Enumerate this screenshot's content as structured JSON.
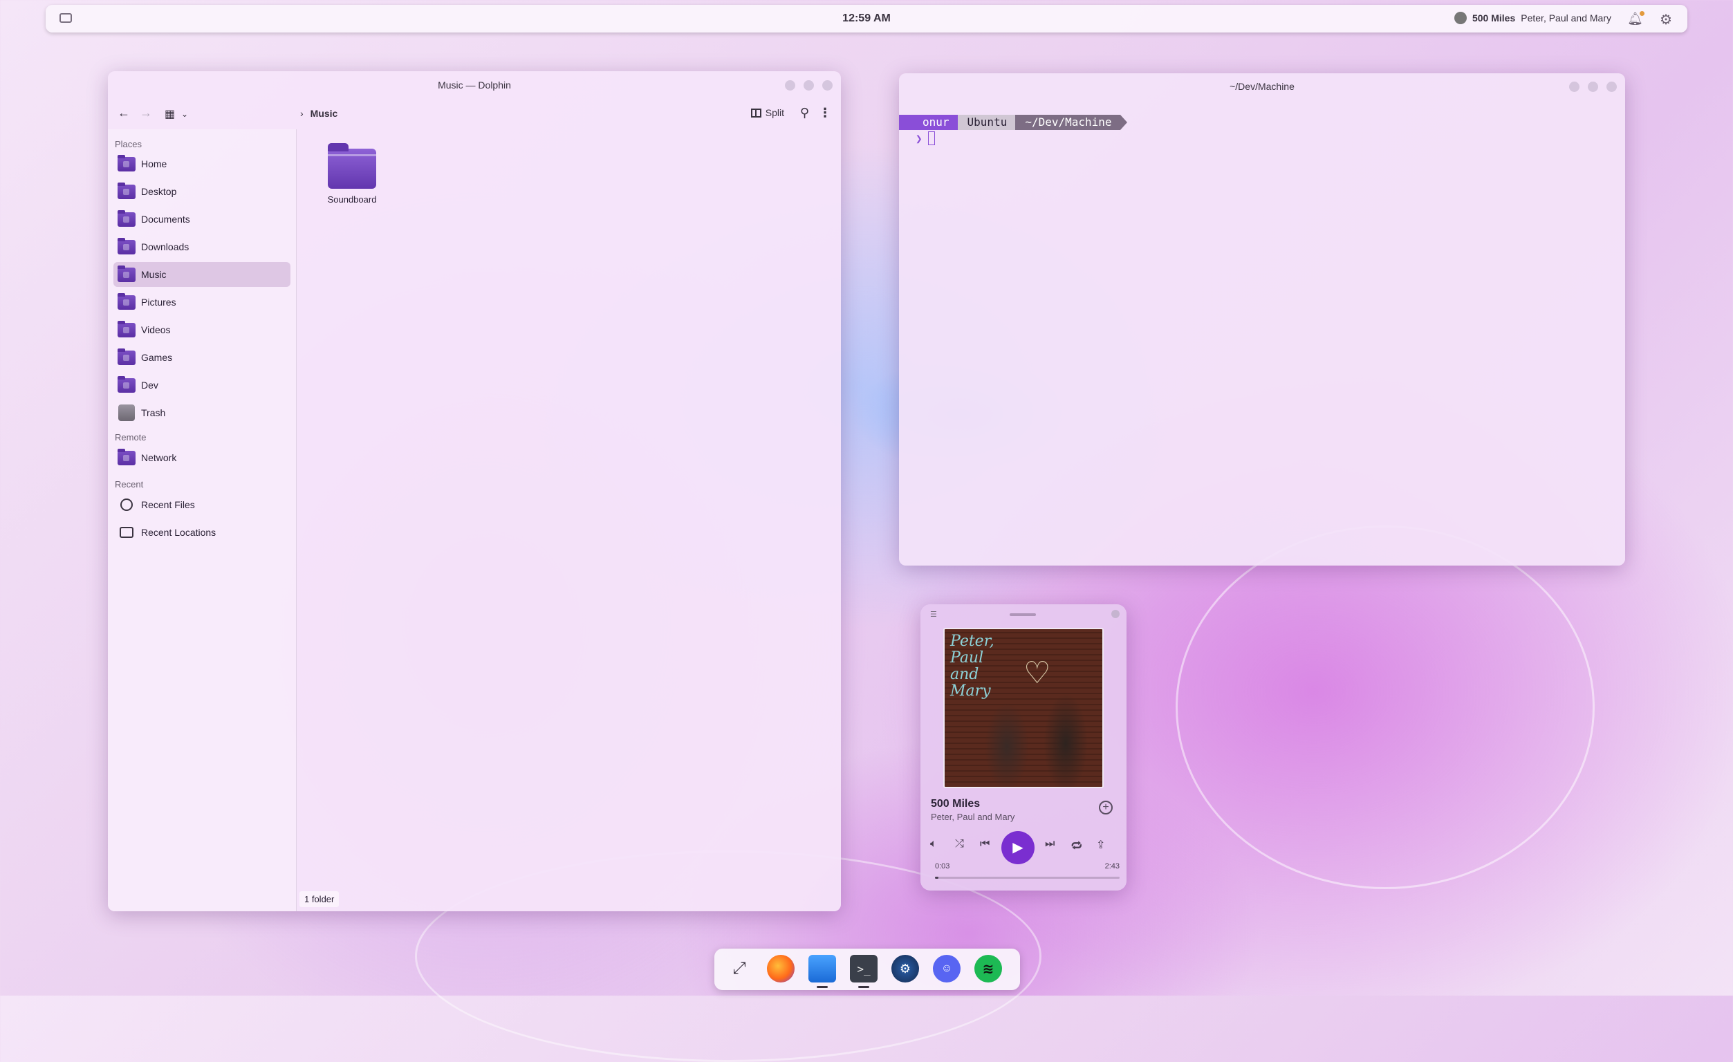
{
  "top_panel": {
    "clock": "12:59 AM",
    "media_title": "500 Miles",
    "media_artist": "Peter, Paul and Mary"
  },
  "dolphin": {
    "title": "Music — Dolphin",
    "breadcrumb": "Music",
    "split_label": "Split",
    "sections": {
      "places": "Places",
      "remote": "Remote",
      "recent": "Recent"
    },
    "places": [
      {
        "label": "Home"
      },
      {
        "label": "Desktop"
      },
      {
        "label": "Documents"
      },
      {
        "label": "Downloads"
      },
      {
        "label": "Music",
        "active": true
      },
      {
        "label": "Pictures"
      },
      {
        "label": "Videos"
      },
      {
        "label": "Games"
      },
      {
        "label": "Dev"
      },
      {
        "label": "Trash"
      }
    ],
    "remote": [
      {
        "label": "Network"
      }
    ],
    "recent": [
      {
        "label": "Recent Files"
      },
      {
        "label": "Recent Locations"
      }
    ],
    "folder_items": [
      {
        "label": "Soundboard"
      }
    ],
    "status": "1 folder"
  },
  "terminal": {
    "title": "~/Dev/Machine",
    "prompt_user": "onur",
    "prompt_host": "Ubuntu",
    "prompt_path": "~/Dev/Machine",
    "prompt_symbol": "❯"
  },
  "music_widget": {
    "album_text": [
      "Peter,",
      "Paul",
      "and",
      "Mary"
    ],
    "song_title": "500 Miles",
    "song_artist": "Peter, Paul and Mary",
    "time_current": "0:03",
    "time_total": "2:43",
    "progress": 0.018
  },
  "dock": {
    "items": [
      {
        "icon": "overview-icon"
      },
      {
        "icon": "firefox-icon"
      },
      {
        "icon": "files-icon"
      },
      {
        "icon": "terminal-icon"
      },
      {
        "icon": "steam-icon"
      },
      {
        "icon": "discord-icon"
      },
      {
        "icon": "spotify-icon"
      }
    ]
  },
  "colors": {
    "accent": "#7a2ed0",
    "folder": "#6236ae",
    "terminal_user": "#8a4ed8"
  }
}
